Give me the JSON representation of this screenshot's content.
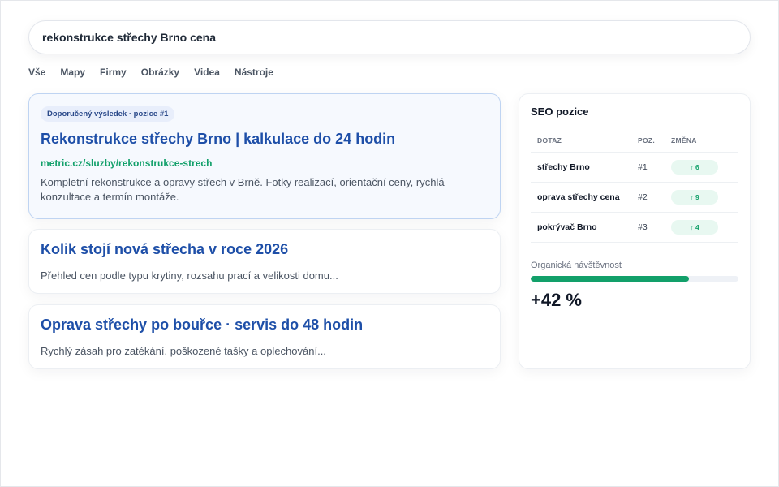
{
  "search": {
    "query": "rekonstrukce střechy Brno cena"
  },
  "tabs": [
    "Vše",
    "Mapy",
    "Firmy",
    "Obrázky",
    "Videa",
    "Nástroje"
  ],
  "results": [
    {
      "badge": "Doporučený výsledek · pozice #1",
      "title": "Rekonstrukce střechy Brno | kalkulace do 24 hodin",
      "url": "metric.cz/sluzby/rekonstrukce-strech",
      "desc": "Kompletní rekonstrukce a opravy střech v Brně. Fotky realizací, orientační ceny, rychlá konzultace a termín montáže."
    },
    {
      "title": "Kolik stojí nová střecha v roce 2026",
      "desc": "Přehled cen podle typu krytiny, rozsahu prací a velikosti domu..."
    },
    {
      "title": "Oprava střechy po bouřce · servis do 48 hodin",
      "desc": "Rychlý zásah pro zatékání, poškozené tašky a oplechování..."
    }
  ],
  "seo": {
    "title": "SEO pozice",
    "headers": [
      "DOTAZ",
      "POZ.",
      "ZMĚNA"
    ],
    "rows": [
      {
        "query": "střechy Brno",
        "pos": "#1",
        "change": "↑ 6"
      },
      {
        "query": "oprava střechy cena",
        "pos": "#2",
        "change": "↑ 9"
      },
      {
        "query": "pokrývač Brno",
        "pos": "#3",
        "change": "↑ 4"
      }
    ],
    "traffic_label": "Organická návštěvnost",
    "traffic_progress": 0.76,
    "traffic_value": "+42 %"
  },
  "colors": {
    "accent": "#1e4fa8",
    "url_green": "#12a06a",
    "progress": "#12a06a"
  }
}
